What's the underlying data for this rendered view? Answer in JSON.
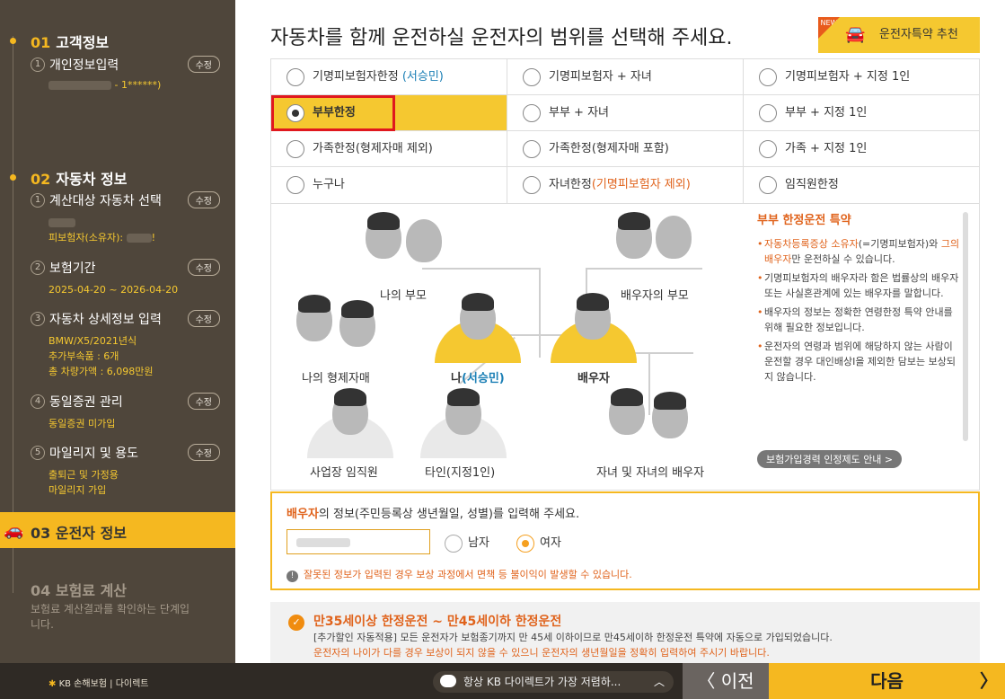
{
  "sidebar": {
    "step1": {
      "num": "01",
      "title": "고객정보"
    },
    "step1_sub": {
      "n": "1",
      "title": "개인정보입력",
      "edit": "수정",
      "detail": "- 1******)"
    },
    "step2": {
      "num": "02",
      "title": "자동차 정보"
    },
    "step2_sub1": {
      "n": "1",
      "title": "계산대상 자동차 선택",
      "edit": "수정",
      "detail": "피보험자(소유자): "
    },
    "step2_sub2": {
      "n": "2",
      "title": "보험기간",
      "edit": "수정",
      "detail": "2025-04-20 ~ 2026-04-20"
    },
    "step2_sub3": {
      "n": "3",
      "title": "자동차 상세정보 입력",
      "edit": "수정",
      "detail1": "BMW/X5/2021년식",
      "detail2": "추가부속품 : 6개",
      "detail3": "총 차량가액 : 6,098만원"
    },
    "step2_sub4": {
      "n": "4",
      "title": "동일증권 관리",
      "edit": "수정",
      "detail": "동일증권 미가입"
    },
    "step2_sub5": {
      "n": "5",
      "title": "마일리지 및 용도",
      "edit": "수정",
      "detail1": "출퇴근 및 가정용",
      "detail2": "마일리지 가입"
    },
    "step3": {
      "num": "03",
      "title": "운전자 정보"
    },
    "step4": {
      "num": "04",
      "title": "보험료 계산",
      "desc": "보험료 계산결과를 확인하는 단계입니다."
    }
  },
  "main": {
    "heading": "자동차를 함께 운전하실 운전자의 범위를 선택해 주세요.",
    "recommend_label": "운전자특약 추천",
    "new_badge": "NEW",
    "options": [
      [
        "기명피보험자한정",
        "기명피보험자 + 자녀",
        "기명피보험자 + 지정 1인"
      ],
      [
        "부부한정",
        "부부 + 자녀",
        "부부 + 지정 1인"
      ],
      [
        "가족한정(형제자매 제외)",
        "가족한정(형제자매 포함)",
        "가족 + 지정 1인"
      ],
      [
        "누구나",
        "자녀한정",
        "임직원한정"
      ]
    ],
    "opt_name": "(서승민)",
    "opt_child_note": "(기명피보험자 제외)"
  },
  "diagram": {
    "parents": "나의 부모",
    "spouse_parents": "배우자의 부모",
    "siblings": "나의 형제자매",
    "me": "나",
    "me_name": "(서승민)",
    "spouse": "배우자",
    "employee": "사업장 임직원",
    "other": "타인(지정1인)",
    "children": "자녀 및 자녀의 배우자"
  },
  "special": {
    "title": "부부 한정운전 특약",
    "b1_hl1": "자동차등록증상 소유자",
    "b1_a": "(=기명피보험자)와 ",
    "b1_hl2": "그의 배우자",
    "b1_b": "만 운전하실 수 있습니다.",
    "b2": "기명피보험자의 배우자라 함은 법률상의 배우자 또는 사실혼관계에 있는 배우자를 말합니다.",
    "b3": "배우자의 정보는 정확한 연령한정 특약 안내를 위해 필요한 정보입니다.",
    "b4": "운전자의 연령과 범위에 해당하지 않는 사람이 운전할 경우 대인배상I을 제외한 담보는 보상되지 않습니다.",
    "guide_btn": "보험가입경력 인정제도 안내 >"
  },
  "spouse_form": {
    "q_strong": "배우자",
    "q_rest": "의 정보(주민등록상 생년월일, 성별)를 입력해 주세요.",
    "male": "남자",
    "female": "여자",
    "warn": "잘못된 정보가 입력된 경우 보상 과정에서 면책 등 불이익이 발생할 수 있습니다."
  },
  "notice": {
    "title": "만35세이상 한정운전 ~ 만45세이하 한정운전",
    "line1": "[추가할인 자동적용] 모든 운전자가 보험종기까지 만 45세 이하이므로 만45세이하 한정운전 특약에 자동으로 가입되었습니다.",
    "line2": "운전자의 나이가 다를 경우 보상이 되지 않을 수 있으니 운전자의 생년월일을 정확히 입력하여 주시기 바랍니다."
  },
  "bottom": {
    "logo": "KB 손해보험 | 다이렉트",
    "chat": "항상 KB 다이렉트가 가장 저렴하...",
    "prev": "이전",
    "next": "다음"
  },
  "colors": {
    "accent": "#f5b820",
    "sidebar": "#4f463b",
    "alert": "#e0631c",
    "highlight": "#e0181e"
  }
}
